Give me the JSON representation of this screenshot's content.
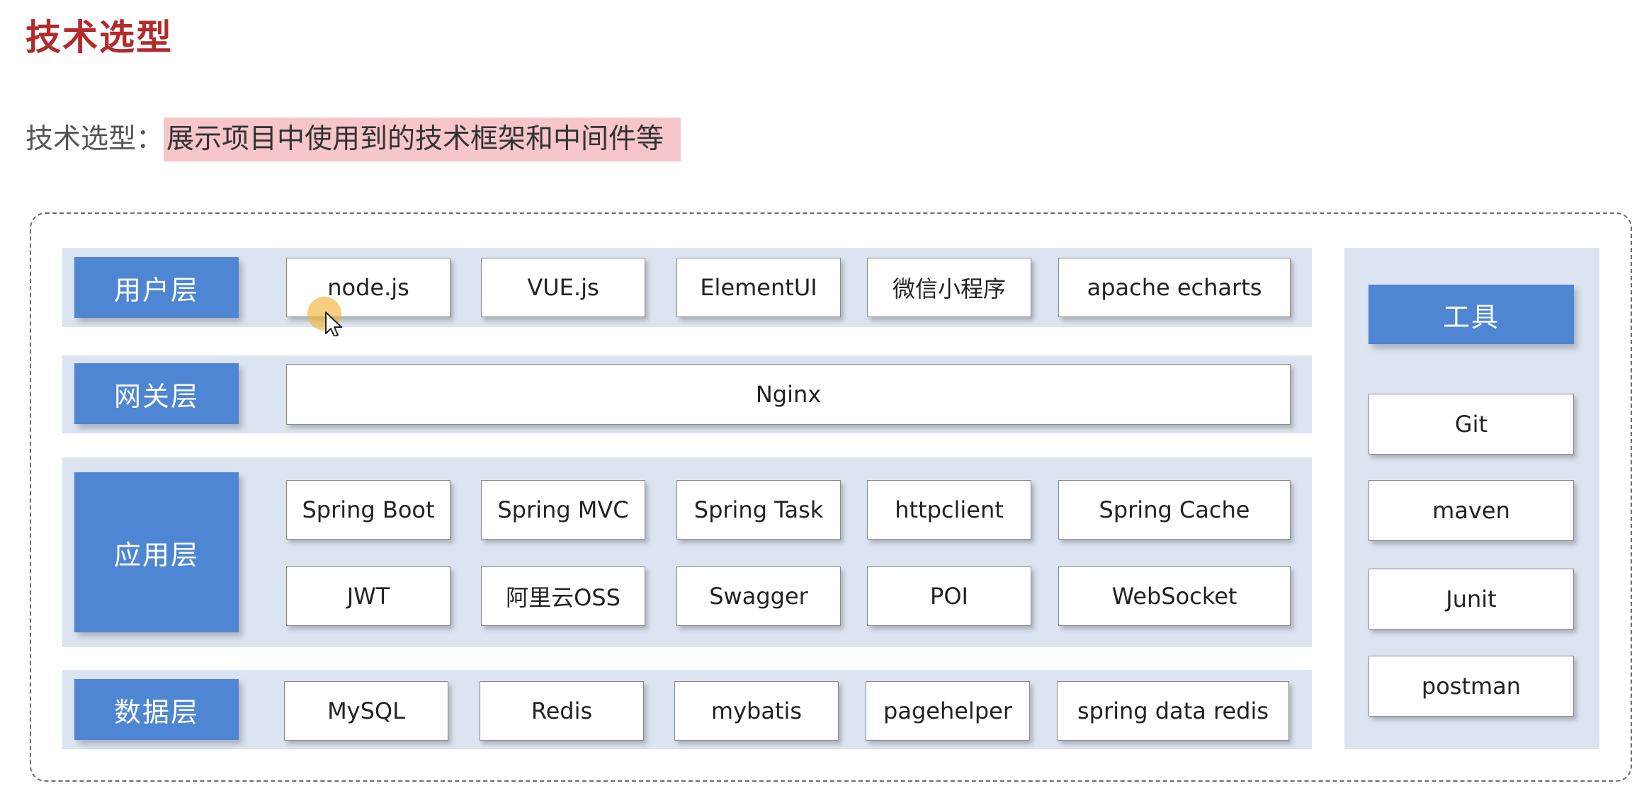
{
  "page": {
    "title": "技术选型",
    "subtitle_prefix": "技术选型：",
    "subtitle_highlight": "展示项目中使用到的技术框架和中间件等"
  },
  "layers": {
    "user": {
      "label": "用户层",
      "items": [
        "node.js",
        "VUE.js",
        "ElementUI",
        "微信小程序",
        "apache echarts"
      ]
    },
    "gateway": {
      "label": "网关层",
      "items": [
        "Nginx"
      ]
    },
    "application": {
      "label": "应用层",
      "row1": [
        "Spring Boot",
        "Spring MVC",
        "Spring Task",
        "httpclient",
        "Spring Cache"
      ],
      "row2": [
        "JWT",
        "阿里云OSS",
        "Swagger",
        "POI",
        "WebSocket"
      ]
    },
    "data": {
      "label": "数据层",
      "items": [
        "MySQL",
        "Redis",
        "mybatis",
        "pagehelper",
        "spring data redis"
      ]
    }
  },
  "tools": {
    "label": "工具",
    "items": [
      "Git",
      "maven",
      "Junit",
      "postman"
    ]
  },
  "colors": {
    "title": "#b22a2a",
    "highlight": "#f6c6cb",
    "band": "#dce4f1",
    "label": "#4f86d3"
  }
}
